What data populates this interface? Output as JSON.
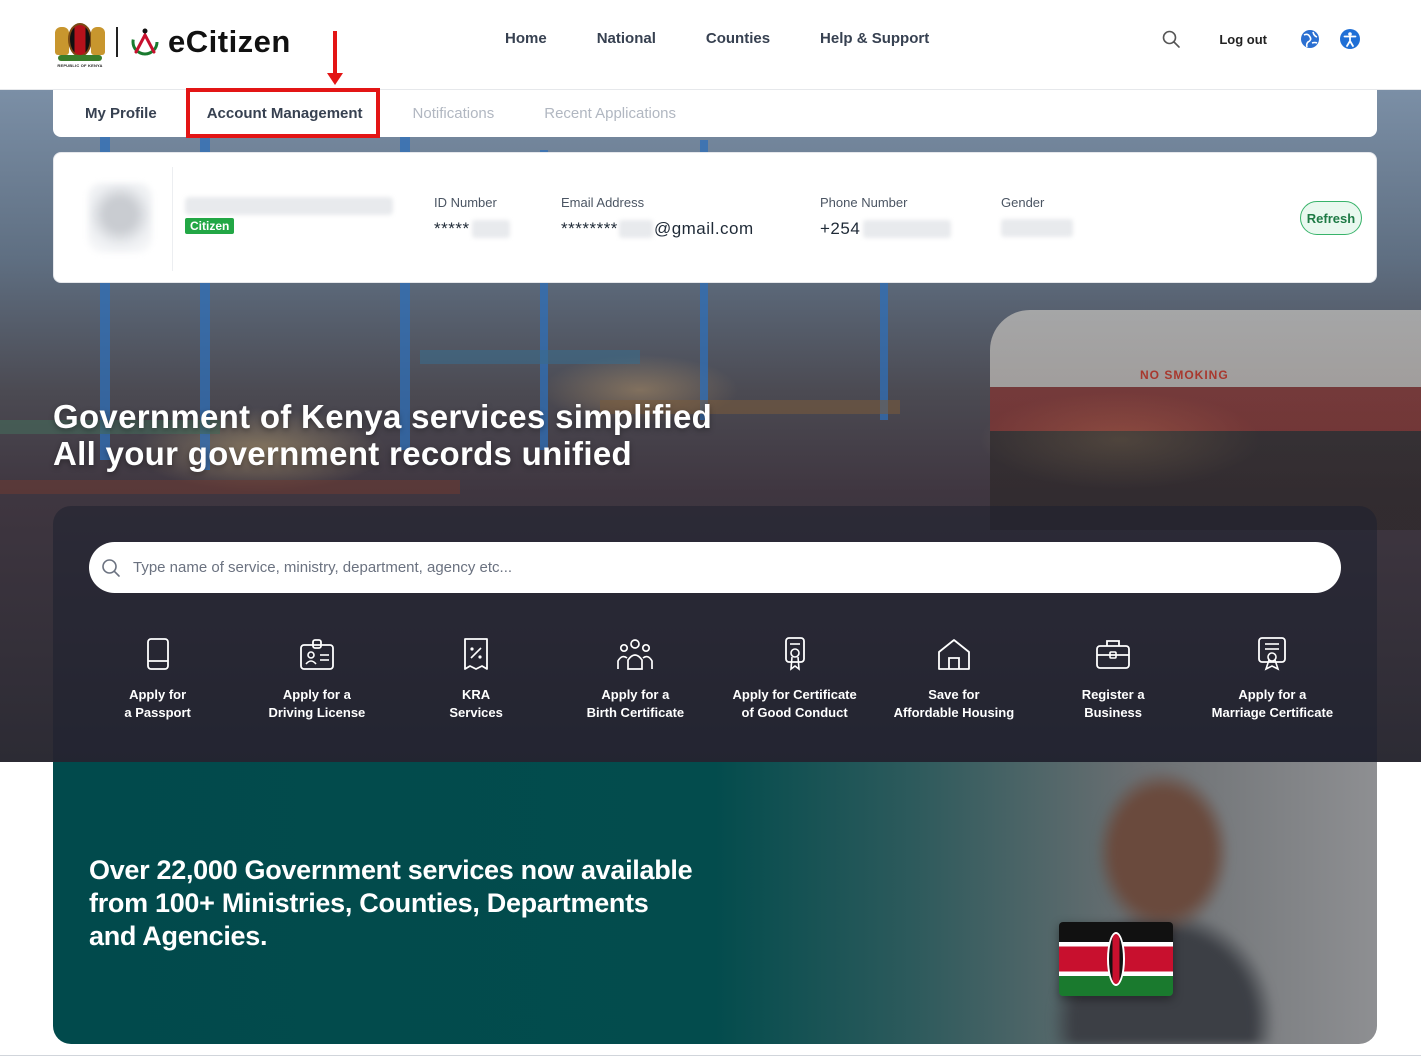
{
  "header": {
    "coat_caption": "REPUBLIC OF KENYA",
    "brand": "eCitizen",
    "nav": [
      "Home",
      "National",
      "Counties",
      "Help & Support"
    ],
    "logout": "Log out",
    "icons": {
      "search": "search-icon",
      "language": "globe-icon",
      "accessibility": "accessibility-icon"
    }
  },
  "tabs": {
    "items": [
      "My Profile",
      "Account Management",
      "Notifications",
      "Recent Applications"
    ],
    "active": "Account Management"
  },
  "profile": {
    "badge": "Citizen",
    "id_label": "ID Number",
    "id_value": "*****",
    "email_label": "Email Address",
    "email_prefix": "********",
    "email_suffix": "@gmail.com",
    "phone_label": "Phone Number",
    "phone_prefix": "+254",
    "gender_label": "Gender",
    "refresh": "Refresh"
  },
  "hero": {
    "line1": "Government of Kenya services simplified",
    "line2": "All your government records unified",
    "ship_sign": "NO SMOKING"
  },
  "search": {
    "placeholder": "Type name of service, ministry, department, agency etc..."
  },
  "services": [
    {
      "icon": "passport-icon",
      "l1": "Apply for",
      "l2": "a Passport"
    },
    {
      "icon": "id-card-icon",
      "l1": "Apply for a",
      "l2": "Driving License"
    },
    {
      "icon": "tax-receipt-icon",
      "l1": "KRA",
      "l2": "Services"
    },
    {
      "icon": "family-icon",
      "l1": "Apply for a",
      "l2": "Birth Certificate"
    },
    {
      "icon": "certificate-badge-icon",
      "l1": "Apply for Certificate",
      "l2": "of Good Conduct"
    },
    {
      "icon": "house-icon",
      "l1": "Save for",
      "l2": "Affordable Housing"
    },
    {
      "icon": "briefcase-icon",
      "l1": "Register a",
      "l2": "Business"
    },
    {
      "icon": "marriage-certificate-icon",
      "l1": "Apply for a",
      "l2": "Marriage Certificate"
    }
  ],
  "promo": {
    "line1": "Over 22,000 Government services now available",
    "line2": "from 100+ Ministries, Counties, Departments",
    "line3": "and Agencies."
  },
  "colors": {
    "accent_red": "#e31515",
    "badge_green": "#22a745",
    "promo_teal": "#014a4c",
    "access_blue": "#1f6fd6"
  }
}
